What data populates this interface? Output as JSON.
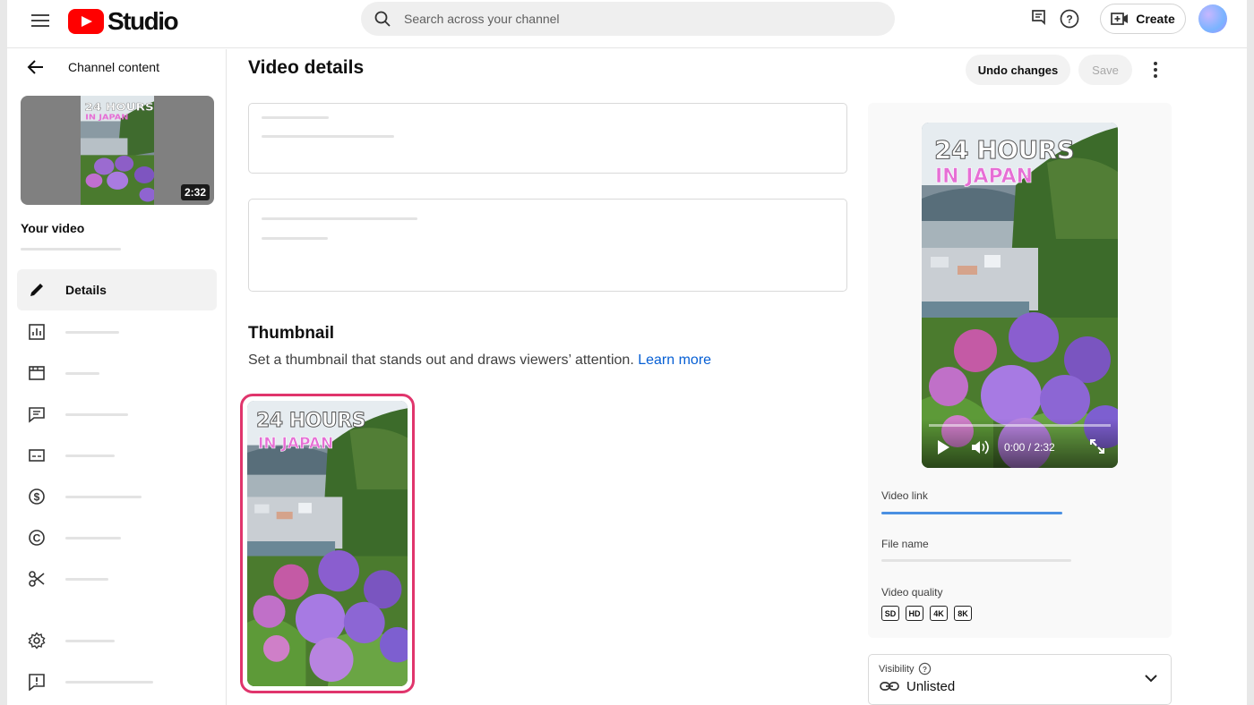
{
  "app": {
    "logo_text": "Studio"
  },
  "search": {
    "placeholder": "Search across your channel"
  },
  "header": {
    "create_label": "Create"
  },
  "sidebar": {
    "back_label": "Channel content",
    "thumbnail_duration": "2:32",
    "your_video_label": "Your video",
    "items": [
      {
        "label": "Details",
        "icon": "pencil-icon",
        "active": true
      },
      {
        "label": "",
        "icon": "analytics-icon"
      },
      {
        "label": "",
        "icon": "editor-icon"
      },
      {
        "label": "",
        "icon": "comments-icon"
      },
      {
        "label": "",
        "icon": "subtitles-icon"
      },
      {
        "label": "",
        "icon": "monetization-icon"
      },
      {
        "label": "",
        "icon": "copyright-icon"
      },
      {
        "label": "",
        "icon": "clips-icon"
      },
      {
        "label": "",
        "icon": "settings-icon"
      },
      {
        "label": "",
        "icon": "feedback-icon"
      }
    ]
  },
  "main": {
    "title": "Video details",
    "undo_label": "Undo changes",
    "save_label": "Save",
    "thumbnail": {
      "heading": "Thumbnail",
      "description": "Set a thumbnail that stands out and draws viewers’ attention.",
      "learn_more": "Learn more",
      "overlay_line1": "24 HOURS",
      "overlay_line2": "IN JAPAN"
    }
  },
  "preview": {
    "overlay_line1": "24 HOURS",
    "overlay_line2": "IN JAPAN",
    "timecode": "0:00 / 2:32",
    "video_link_label": "Video link",
    "file_name_label": "File name",
    "video_quality_label": "Video quality",
    "qualities": [
      "SD",
      "HD",
      "4K",
      "8K"
    ]
  },
  "visibility": {
    "label": "Visibility",
    "value": "Unlisted"
  },
  "colors": {
    "accent_red": "#ff0000",
    "selection_border": "#e0356c",
    "link_blue": "#065fd4",
    "progress_blue": "#4a90e2"
  }
}
